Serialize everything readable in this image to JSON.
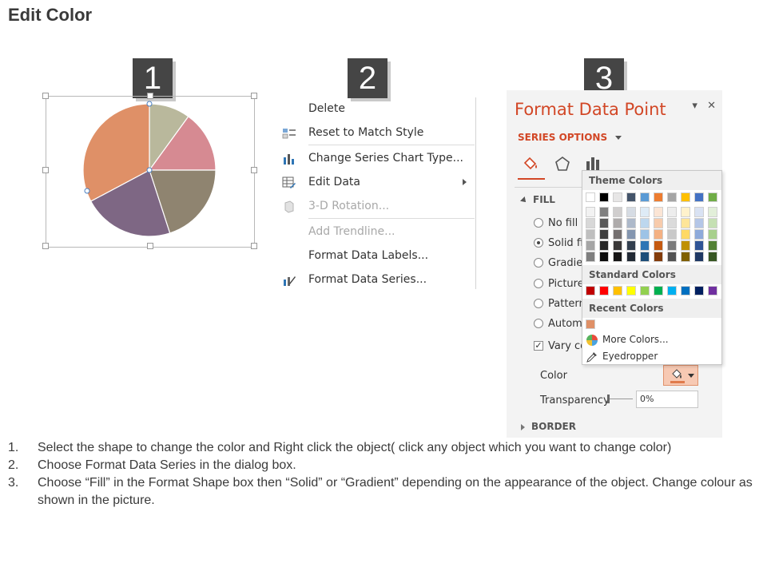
{
  "page": {
    "title": "Edit Color"
  },
  "badges": [
    "1",
    "2",
    "3"
  ],
  "pie": {
    "slices": [
      {
        "name": "slice-olive",
        "color": "#b9b89c"
      },
      {
        "name": "slice-pink",
        "color": "#d68a92"
      },
      {
        "name": "slice-taupe",
        "color": "#8f8470"
      },
      {
        "name": "slice-purple",
        "color": "#7e6784"
      },
      {
        "name": "slice-orange",
        "color": "#df9067"
      }
    ]
  },
  "context_menu": {
    "delete": "Delete",
    "reset": "Reset to Match Style",
    "change_type": "Change Series Chart Type...",
    "edit_data": "Edit Data",
    "rotation": "3-D Rotation...",
    "trendline": "Add Trendline...",
    "labels": "Format Data Labels...",
    "series": "Format Data Series..."
  },
  "format_pane": {
    "title": "Format Data Point",
    "series_options": "SERIES OPTIONS",
    "fill": "FILL",
    "no_fill": "No fill",
    "solid": "Solid fi",
    "gradient": "Gradien",
    "picture": "Picture",
    "pattern": "Pattern",
    "automatic": "Automa",
    "vary": "Vary co",
    "color": "Color",
    "transparency": "Transparency",
    "transparency_value": "0%",
    "border": "BORDER",
    "accent": "#d24726"
  },
  "palette": {
    "theme_colors": "Theme Colors",
    "standard_colors": "Standard Colors",
    "recent_colors": "Recent Colors",
    "more_colors": "More Colors...",
    "eyedropper": "Eyedropper",
    "theme_top": [
      "#ffffff",
      "#000000",
      "#e7e6e6",
      "#44546a",
      "#5b9bd5",
      "#ed7d31",
      "#a5a5a5",
      "#ffc000",
      "#4472c4",
      "#70ad47"
    ],
    "theme_shades": [
      [
        "#f2f2f2",
        "#7f7f7f",
        "#d0cece",
        "#d6dce4",
        "#deebf6",
        "#fbe5d5",
        "#ededed",
        "#fff2cc",
        "#d9e2f3",
        "#e2efd9"
      ],
      [
        "#d8d8d8",
        "#595959",
        "#aeabab",
        "#adb9ca",
        "#bdd7ee",
        "#f7cbac",
        "#dbdbdb",
        "#fee599",
        "#b4c6e7",
        "#c5e0b3"
      ],
      [
        "#bfbfbf",
        "#3f3f3f",
        "#757070",
        "#8496b0",
        "#9dc3e6",
        "#f4b183",
        "#c9c9c9",
        "#ffd966",
        "#8eaadb",
        "#a8d08d"
      ],
      [
        "#a5a5a5",
        "#262626",
        "#3a3838",
        "#323f4f",
        "#2e75b5",
        "#c55a11",
        "#7b7b7b",
        "#bf9000",
        "#2f5496",
        "#538135"
      ],
      [
        "#7f7f7f",
        "#0c0c0c",
        "#171616",
        "#222a35",
        "#1e4e79",
        "#833c0b",
        "#525252",
        "#7f6000",
        "#1f3864",
        "#375623"
      ]
    ],
    "standard": [
      "#c00000",
      "#ff0000",
      "#ffc000",
      "#ffff00",
      "#92d050",
      "#00b050",
      "#00b0f0",
      "#0070c0",
      "#002060",
      "#7030a0"
    ],
    "recent": [
      "#df9067"
    ]
  },
  "instructions": [
    {
      "num": "1.",
      "text": "Select the shape to change the color and Right click the object( click any object which you want to change color)"
    },
    {
      "num": "2.",
      "text": "Choose Format Data Series in the dialog box."
    },
    {
      "num": "3.",
      "text": "Choose “Fill” in the Format Shape box then “Solid” or “Gradient” depending on the appearance of the object. Change colour as shown in the picture."
    }
  ]
}
